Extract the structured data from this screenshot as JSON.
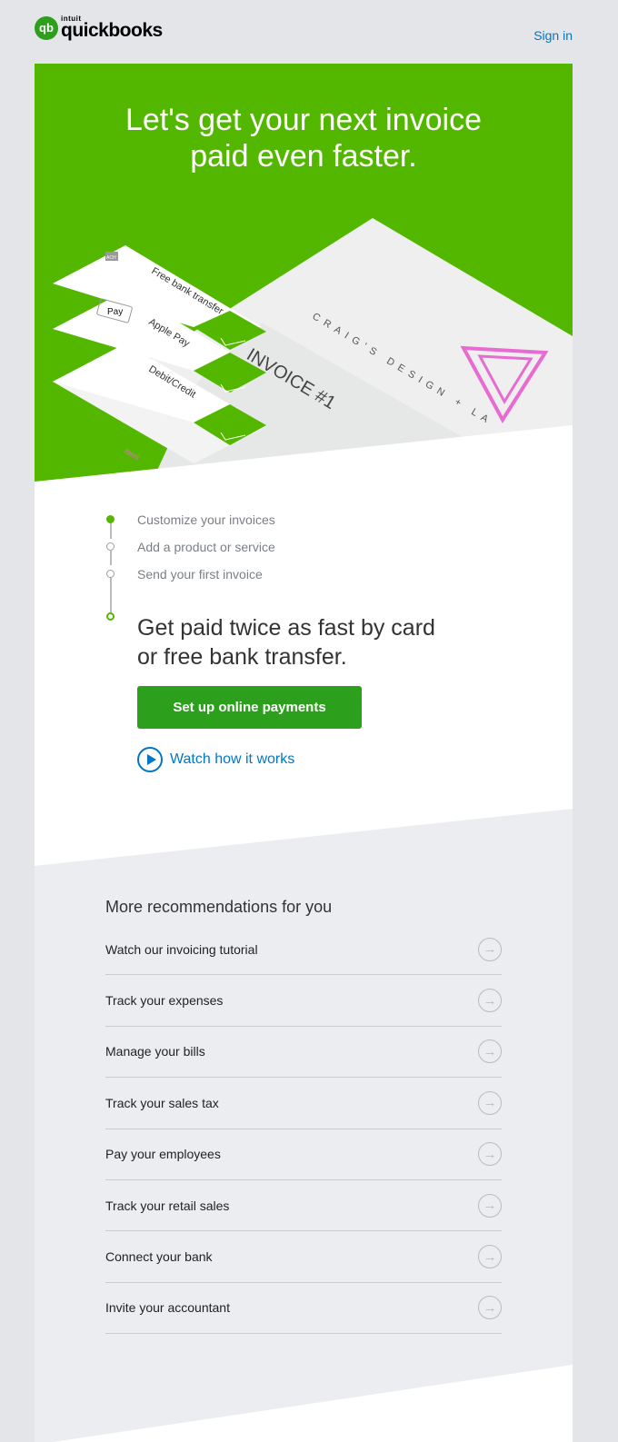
{
  "header": {
    "logo_small": "intuit",
    "logo_main": "quickbooks",
    "logo_mark": "qb",
    "sign_in": "Sign in"
  },
  "hero": {
    "title_line1": "Let's get your next invoice",
    "title_line2": "paid even faster.",
    "illustration": {
      "options": [
        "Free bank transfer",
        "Apple Pay",
        "Debit/Credit"
      ],
      "ach": "ACH",
      "apple_pay": "Pay",
      "invoice": "INVOICE #1",
      "company": "CRAIG'S DESIGN + LA",
      "item": "Item"
    }
  },
  "steps": [
    {
      "label": "Customize your invoices",
      "state": "done"
    },
    {
      "label": "Add a product or service",
      "state": "todo"
    },
    {
      "label": "Send your first invoice",
      "state": "todo"
    }
  ],
  "main": {
    "headline_line1": "Get paid twice as fast by card",
    "headline_line2": "or free bank transfer.",
    "cta": "Set up online payments",
    "watch": "Watch how it works"
  },
  "recommendations": {
    "title": "More recommendations for you",
    "items": [
      "Watch our invoicing tutorial",
      "Track your expenses",
      "Manage your bills",
      "Track your sales tax",
      "Pay your employees",
      "Track your retail sales",
      "Connect your bank",
      "Invite your accountant"
    ]
  },
  "colors": {
    "brand_green": "#53b700",
    "button_green": "#2ca01c",
    "link_blue": "#0077c5"
  }
}
